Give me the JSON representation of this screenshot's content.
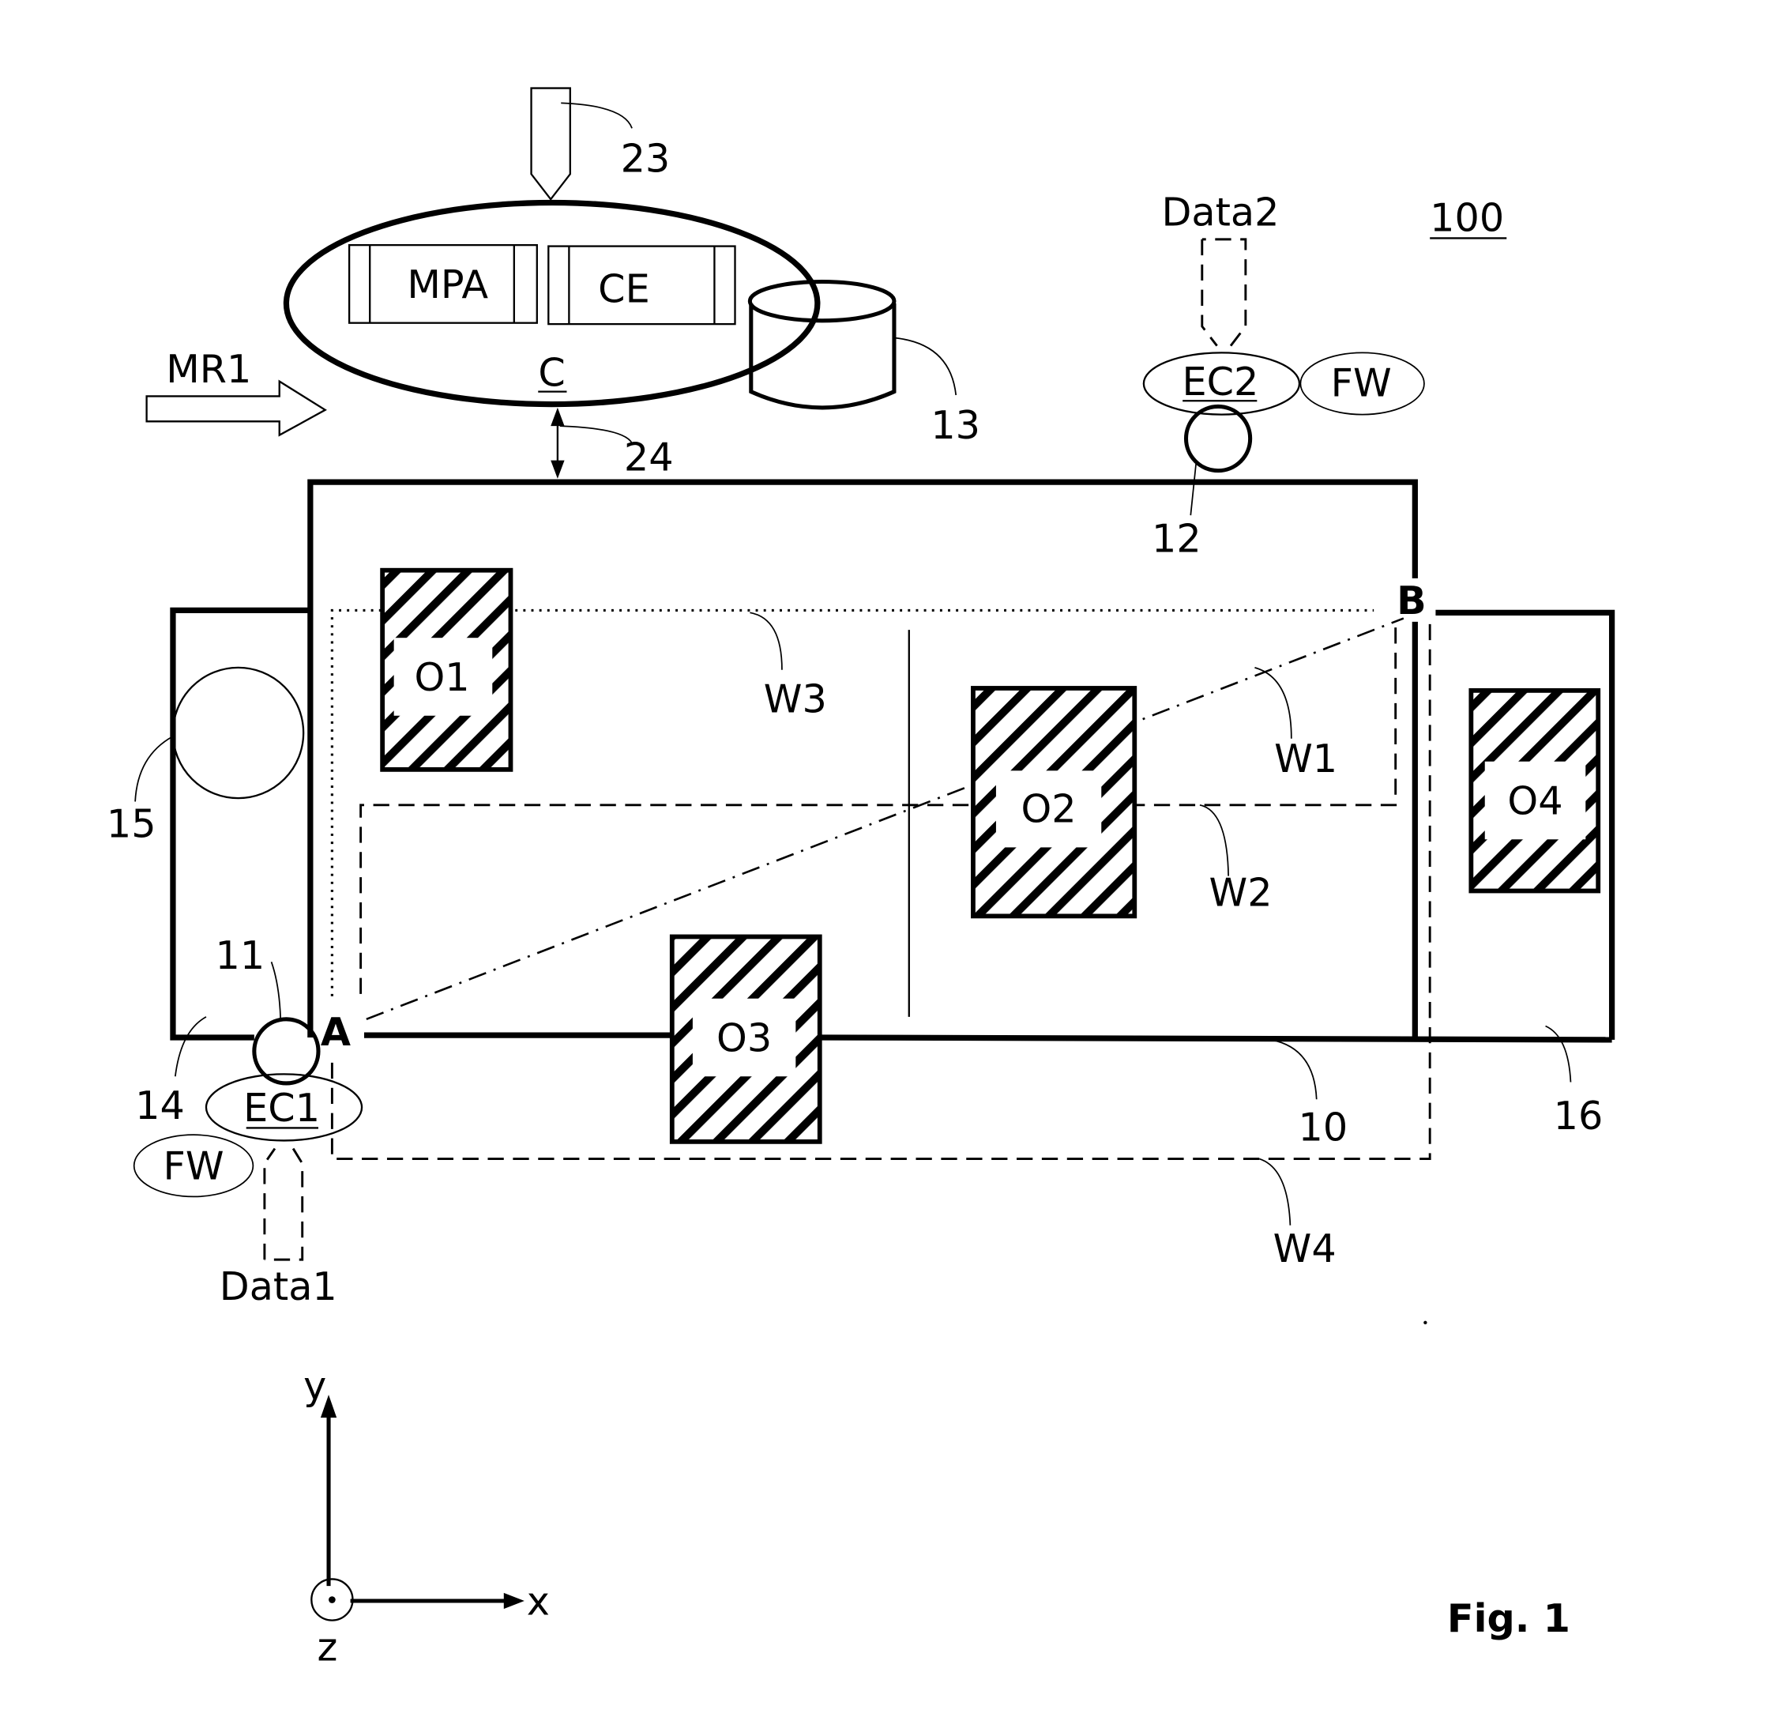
{
  "figure": {
    "caption": "Fig. 1",
    "system_ref": "100"
  },
  "controller": {
    "label": "C",
    "modules": [
      {
        "label": "MPA"
      },
      {
        "label": "CE"
      }
    ],
    "input_ref": "23",
    "link_ref": "24",
    "storage_ref": "13"
  },
  "movement": {
    "label": "MR1"
  },
  "rooms": {
    "main_ref": "10",
    "left_ref": "14",
    "right_ref": "16",
    "left_object_ref": "15"
  },
  "entrances": {
    "a_label": "A",
    "b_label": "B"
  },
  "edge_controllers": [
    {
      "label": "EC1",
      "sensor_ref": "11",
      "firmware": "FW",
      "data": "Data1"
    },
    {
      "label": "EC2",
      "sensor_ref": "12",
      "firmware": "FW",
      "data": "Data2"
    }
  ],
  "obstacles": [
    "O1",
    "O2",
    "O3",
    "O4"
  ],
  "paths": [
    "W1",
    "W2",
    "W3",
    "W4"
  ],
  "axes": {
    "x": "x",
    "y": "y",
    "z": "z"
  }
}
